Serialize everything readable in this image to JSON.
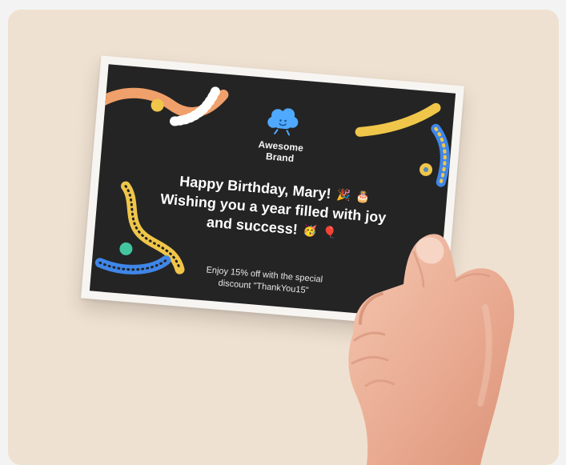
{
  "brand": {
    "name": "Awesome Brand",
    "icon": "cloud-mascot-icon"
  },
  "message": {
    "line1": "Happy Birthday, Mary!",
    "line2": "Wishing you a year filled with joy",
    "line3": "and success!",
    "emoji1": "🎉",
    "emoji2": "🎂",
    "emoji3": "🥳",
    "emoji4": "🎈"
  },
  "discount": {
    "line1": "Enjoy 15% off with the special",
    "line2": "discount \"ThankYou15\""
  },
  "colors": {
    "background": "#efe1d1",
    "card_border": "#f7f5f2",
    "card_fill": "#242424",
    "brand_blue": "#4fa9ff",
    "accent_orange": "#f0a06a",
    "accent_yellow": "#f0c64a",
    "accent_blue": "#3f86e8",
    "accent_green": "#42c6a0"
  }
}
